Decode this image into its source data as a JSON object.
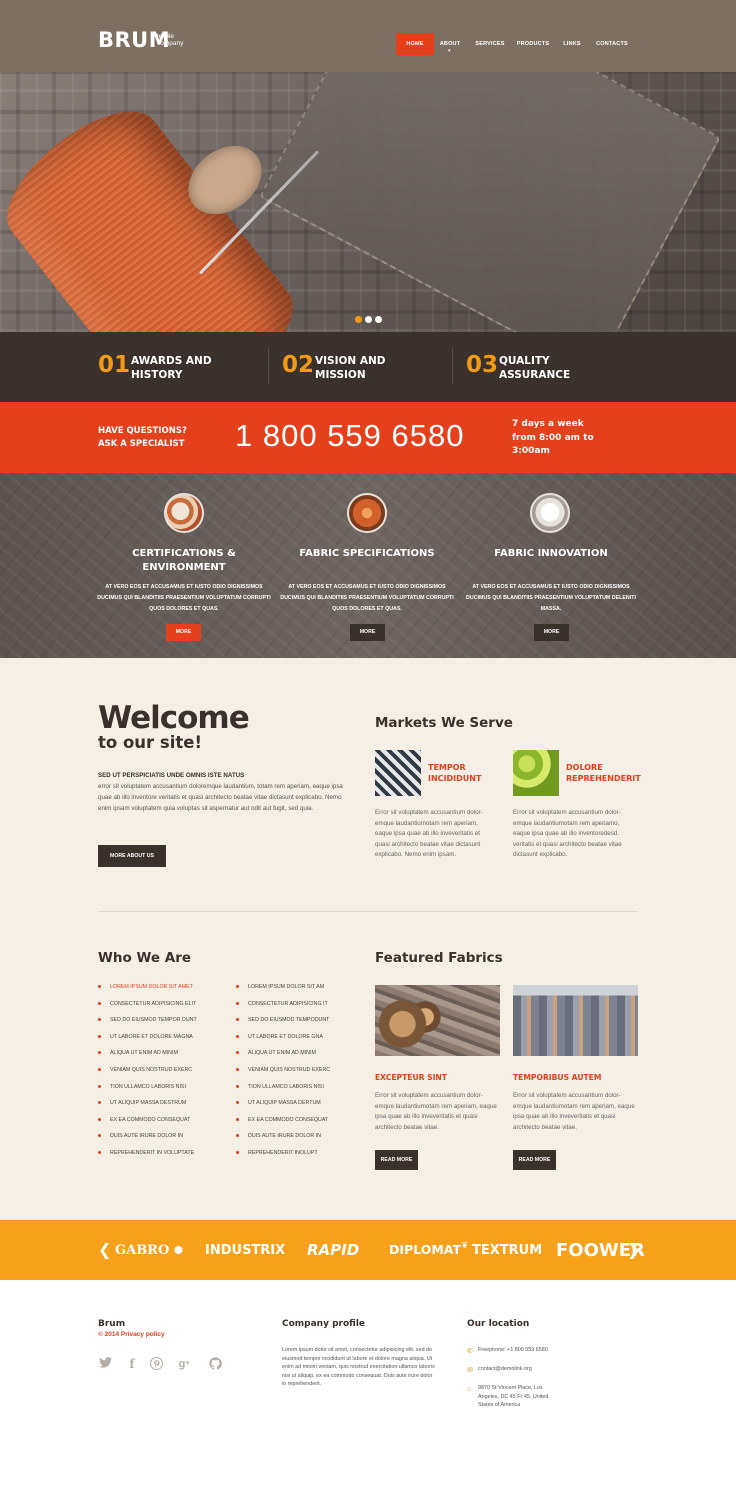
{
  "header": {
    "logo": "BRUM",
    "logo_sub": "textile company",
    "nav": [
      {
        "label": "Home",
        "active": true
      },
      {
        "label": "About"
      },
      {
        "label": "Services"
      },
      {
        "label": "Products"
      },
      {
        "label": "Links"
      },
      {
        "label": "Contacts"
      }
    ]
  },
  "hero": {
    "slides": 3,
    "active_slide": 1
  },
  "features": [
    {
      "num": "01",
      "title": "Awards and History"
    },
    {
      "num": "02",
      "title": "Vision and Mission"
    },
    {
      "num": "03",
      "title": "Quality Assurance"
    }
  ],
  "contact": {
    "question": "Have questions? Ask a specialist",
    "phone": "1 800 559 6580",
    "hours": "7 days a week from 8:00 am to 3:00am"
  },
  "services": [
    {
      "title": "Certifications & Environment",
      "text": "At vero eos et accusamus et iusto odio dignissimos ducimus qui blanditiis praesentium voluptatum corrupti quos dolores et quas.",
      "button": "More"
    },
    {
      "title": "Fabric Specifications",
      "text": "At vero eos et accusamus et iusto odio dignissimos ducimus qui blanditiis praesentium voluptatum corrupti quos dolores et quas.",
      "button": "More"
    },
    {
      "title": "Fabric Innovation",
      "text": "At vero eos et accusamus et iusto odio dignissimos ducimus qui blanditiis praesentium voluptatum deleniti massa.",
      "button": "More"
    }
  ],
  "welcome": {
    "title": "Welcome",
    "subtitle": "to our site!",
    "lead": "Sed ut perspiciatis unde omnis iste natus",
    "body": "error sit voluptatem accusantium doloremque laudantium, totam rem aperiam, eaque ipsa quae ab illo inventore veritatis et quasi architecto beatae vitae dictasunt explicabo. Nemo enim ipsam voluptatem quia voluptas sit aspernatur aut odit aut fugit, sed quia.",
    "button": "More about us"
  },
  "markets": {
    "title": "Markets We Serve",
    "items": [
      {
        "title": "Tempor incididunt",
        "text": "Error sit voluptatem accusantium dolor-emque laudantiumotam rem aperiam, eaque ipsa quae ab illo inveveritatis et quasi architecto beatae vitae dictasunt explicabo. Nemo enim ipsam."
      },
      {
        "title": "Dolore reprehenderit",
        "text": "Error sit voluptatem accusantium dolor-emque laudantiumotam rem aperiamo, eaque ipsa quae ab illo inventoredesd. veritatis et quasi architecto beatae vitae dictasunt explicabo."
      }
    ]
  },
  "who": {
    "title": "Who We Are",
    "col1": [
      "Lorem ipsum dolor sit amet",
      "Consectetur adipisicing elit",
      "Sed do eiusmod tempor dunt",
      "Ut labore et dolore magna",
      "Aliqua ut enim ad minim",
      "Veniam quis nostrud exerc",
      "Tion ullamco laboris nisi",
      "Ut aliquip massa destrum",
      "Ex ea commodo consequat",
      "Duis aute irure dolor in",
      "Reprehenderit in voluptate"
    ],
    "col2": [
      "Lorem ipsum dolor sit am",
      "Consectetur adipisicing it",
      "Sed do eiusmod tempodunt",
      "Ut labore et dolore gna",
      "Aliqua ut enim ad minim",
      "Veniam quis nostrud exerc",
      "Tion ullamco laboris nisi",
      "Ut aliquip massa dertum",
      "Ex ea commodo consequat",
      "Duis aute irure dolor in",
      "Reprehenderit inolupt"
    ]
  },
  "fabrics": {
    "title": "Featured Fabrics",
    "items": [
      {
        "title": "Excepteur sint",
        "text": "Error sit voluptatem accusantium dolor-emque laudantiumotam rem aperiam, eaque ipsa quae ab illo inveveritatis et quasi architecto beatae vitae.",
        "button": "Read more"
      },
      {
        "title": "Temporibus autem",
        "text": "Error sit voluptatem accusantium dolor-emque laudantiumotam rem aperiam, eaque ipsa quae ab illo inveveritatis et quasi architecto beatae vitae.",
        "button": "Read more"
      }
    ]
  },
  "brands": [
    "GABRO",
    "INDUSTRIX",
    "RAPID",
    "DIPLOMAT",
    "TEXTRUM",
    "FOOWER"
  ],
  "footer": {
    "brand": "Brum",
    "copyright": "© 2014 Privacy policy",
    "social": [
      "twitter-icon",
      "facebook-icon",
      "pinterest-icon",
      "google-plus-icon",
      "github-icon"
    ],
    "profile_title": "Company profile",
    "profile_text": "Lorem ipsum dolor sit amet, consectetur adipisicing elit, sed do eiusmod tempor incididunt ut labore et dolore magna aliqua. Ut enim ad minim veniam, quis nostrud exercitation ullamco laboris nisi ut aliquip. ex ea commodo consequat. Duis aute irure dolor in reprehenderit.",
    "location_title": "Our location",
    "phone": "Freephone:   +1 800 559 6580",
    "email": "contact@demolink.org",
    "address": "9870 St Vincent Place, Los Angeles, DC 45 Fr 45. United States of America"
  },
  "colors": {
    "accent": "#e5401c",
    "header": "#7d7062",
    "dark": "#3a312c",
    "orange": "#f39a13",
    "brand_strip": "#f7a11a"
  }
}
